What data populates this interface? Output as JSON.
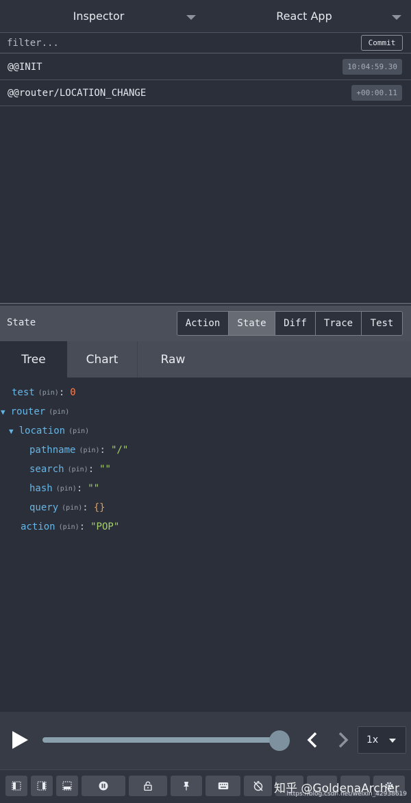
{
  "header": {
    "left_select": "Inspector",
    "right_select": "React App"
  },
  "filter": {
    "placeholder": "filter...",
    "commit_label": "Commit"
  },
  "actions": [
    {
      "name": "@@INIT",
      "time": "10:04:59.30"
    },
    {
      "name": "@@router/LOCATION_CHANGE",
      "time": "+00:00.11"
    }
  ],
  "monitor": {
    "title": "State",
    "tabs": [
      "Action",
      "State",
      "Diff",
      "Trace",
      "Test"
    ],
    "active_tab": "State"
  },
  "view_tabs": {
    "items": [
      "Tree",
      "Chart",
      "Raw"
    ],
    "active": "Tree"
  },
  "tree": {
    "pin": "(pin)",
    "colon": ":",
    "test": {
      "key": "test",
      "value": "0"
    },
    "router": {
      "key": "router"
    },
    "location": {
      "key": "location"
    },
    "pathname": {
      "key": "pathname",
      "value": "\"/\""
    },
    "search": {
      "key": "search",
      "value": "\"\""
    },
    "hash": {
      "key": "hash",
      "value": "\"\""
    },
    "query": {
      "key": "query",
      "value": "{}"
    },
    "action": {
      "key": "action",
      "value": "\"POP\""
    }
  },
  "player": {
    "progress": 1.0,
    "speed": "1x"
  },
  "watermark": {
    "text": "知乎 @GoldenaArcher",
    "url": "https://blog.csdn.net/weixin_42938619"
  },
  "colors": {
    "background": "#2a2f3a",
    "key": "#67b6e5",
    "number": "#ff7d4a",
    "string": "#a8d06a",
    "object": "#e0a060",
    "active_tab": "#666b74"
  },
  "icons": [
    "chevron-down-icon",
    "play-icon",
    "chevron-left-icon",
    "chevron-right-icon",
    "dock-left-icon",
    "dock-right-icon",
    "dock-bottom-icon",
    "pause-icon",
    "lock-icon",
    "pin-icon",
    "keyboard-icon",
    "timer-off-icon",
    "settings-icon"
  ]
}
